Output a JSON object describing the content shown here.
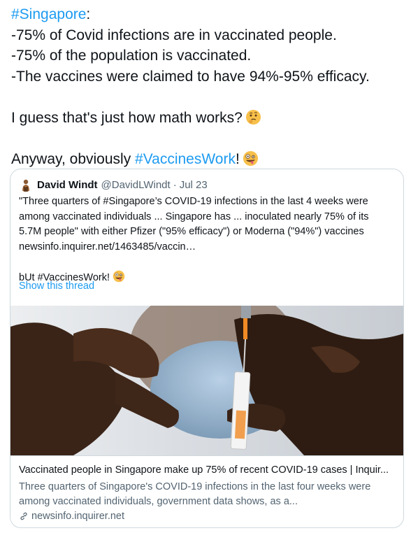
{
  "tweet": {
    "lines": [
      {
        "tag": "#Singapore",
        "rest": ":"
      },
      "-75% of Covid infections are in vaccinated people.",
      "-75% of the population is vaccinated.",
      "-The vaccines were claimed to have 94%-95% efficacy.",
      "I guess that's just how math works?",
      {
        "before": "Anyway, obviously ",
        "tag": "#VaccinesWork",
        "after": "!"
      }
    ],
    "emojis": [
      "thinking-face-emoji",
      "zany-face-emoji"
    ]
  },
  "quote": {
    "author_name": "David Windt",
    "author_handle": "@DavidLWindt",
    "separator": "·",
    "date": "Jul 23",
    "body_lines": [
      "\"Three quarters of #Singapore’s COVID-19 infections in the last 4 weeks were",
      "among vaccinated individuals ... Singapore has ... inoculated nearly 75% of its",
      "5.7M people\" with either Pfizer (\"95% efficacy\") or Moderna (\"94%\") vaccines",
      "newsinfo.inquirer.net/1463485/vaccin…"
    ],
    "closing": "bUt #VaccinesWork!",
    "show_thread": "Show this thread"
  },
  "link_card": {
    "title": "Vaccinated people in Singapore make up 75% of recent COVID-19 cases | Inquir...",
    "description_lines": [
      "Three quarters of Singapore's COVID-19 infections in the last four weeks were",
      "among vaccinated individuals, government data shows, as a..."
    ],
    "domain": "newsinfo.inquirer.net"
  },
  "colors": {
    "link_blue": "#1d9bf0",
    "text_primary": "#0f1419",
    "text_secondary": "#536471",
    "border": "#cfd9de"
  }
}
